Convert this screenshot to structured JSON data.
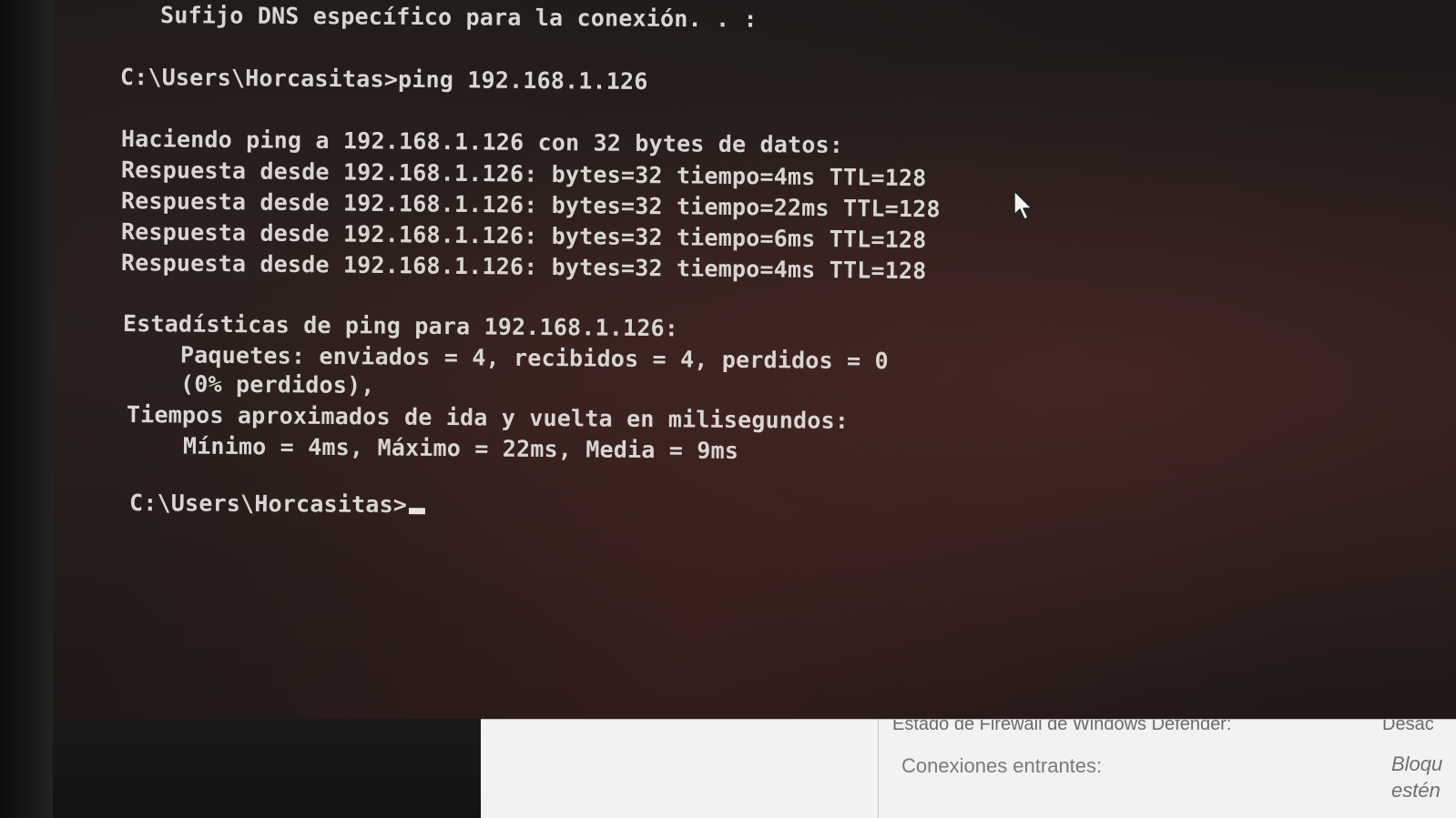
{
  "console": {
    "lines": [
      "Sufijo DNS específico para la conexión. . :",
      "C:\\Users\\Horcasitas>ping 192.168.1.126",
      "Haciendo ping a 192.168.1.126 con 32 bytes de datos:",
      "Respuesta desde 192.168.1.126: bytes=32 tiempo=4ms TTL=128",
      "Respuesta desde 192.168.1.126: bytes=32 tiempo=22ms TTL=128",
      "Respuesta desde 192.168.1.126: bytes=32 tiempo=6ms TTL=128",
      "Respuesta desde 192.168.1.126: bytes=32 tiempo=4ms TTL=128",
      "Estadísticas de ping para 192.168.1.126:",
      "    Paquetes: enviados = 4, recibidos = 4, perdidos = 0",
      "    (0% perdidos),",
      "Tiempos aproximados de ida y vuelta en milisegundos:",
      "    Mínimo = 4ms, Máximo = 22ms, Media = 9ms"
    ],
    "prompt": "C:\\Users\\Horcasitas>"
  },
  "firewall_panel": {
    "status_label": "Estado de Firewall de Windows Defender:",
    "status_value": "Desac",
    "incoming_label": "Conexiones entrantes:",
    "incoming_value_line1": "Bloqu",
    "incoming_value_line2": "estén"
  },
  "icons": {
    "pointer": "mouse-pointer-icon",
    "cursor": "text-cursor"
  }
}
